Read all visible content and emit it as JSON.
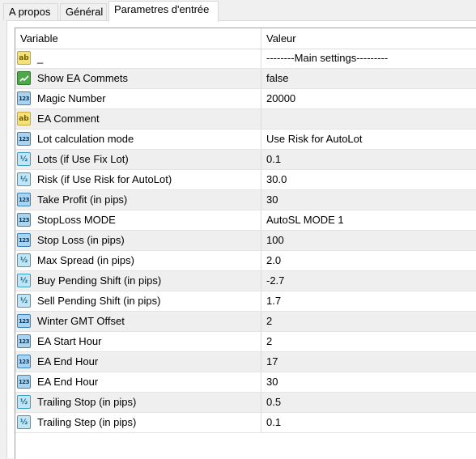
{
  "tabs": [
    "A propos",
    "Général",
    "Parametres d'entrée"
  ],
  "table": {
    "col_variable": "Variable",
    "col_value": "Valeur",
    "rows": [
      {
        "icon": "ab",
        "name": "_",
        "value": "--------Main settings---------"
      },
      {
        "icon": "bool",
        "name": "Show EA Commets",
        "value": "false"
      },
      {
        "icon": "123",
        "name": "Magic Number",
        "value": "20000"
      },
      {
        "icon": "ab",
        "name": "EA Comment",
        "value": ""
      },
      {
        "icon": "123",
        "name": "Lot calculation mode",
        "value": "Use Risk for AutoLot"
      },
      {
        "icon": "half",
        "name": "Lots (if Use Fix Lot)",
        "value": "0.1"
      },
      {
        "icon": "half",
        "name": "Risk (if Use Risk for AutoLot)",
        "value": "30.0"
      },
      {
        "icon": "123",
        "name": "Take Profit (in pips)",
        "value": "30"
      },
      {
        "icon": "123",
        "name": "StopLoss MODE",
        "value": "AutoSL MODE 1"
      },
      {
        "icon": "123",
        "name": "Stop Loss (in pips)",
        "value": "100"
      },
      {
        "icon": "half",
        "name": "Max Spread (in pips)",
        "value": "2.0"
      },
      {
        "icon": "half",
        "name": "Buy Pending Shift (in pips)",
        "value": "-2.7"
      },
      {
        "icon": "half",
        "name": "Sell Pending Shift (in pips)",
        "value": "1.7"
      },
      {
        "icon": "123",
        "name": "Winter GMT Offset",
        "value": "2"
      },
      {
        "icon": "123",
        "name": "EA Start Hour",
        "value": "2"
      },
      {
        "icon": "123",
        "name": "EA End Hour",
        "value": "17"
      },
      {
        "icon": "123",
        "name": "EA End Hour",
        "value": "30"
      },
      {
        "icon": "half",
        "name": "Trailing Stop (in pips)",
        "value": "0.5"
      },
      {
        "icon": "half",
        "name": "Trailing Step (in pips)",
        "value": "0.1"
      }
    ]
  },
  "icon_names": {
    "ab": "string-type-icon",
    "123": "integer-type-icon",
    "half": "double-type-icon",
    "bool": "bool-type-icon"
  }
}
